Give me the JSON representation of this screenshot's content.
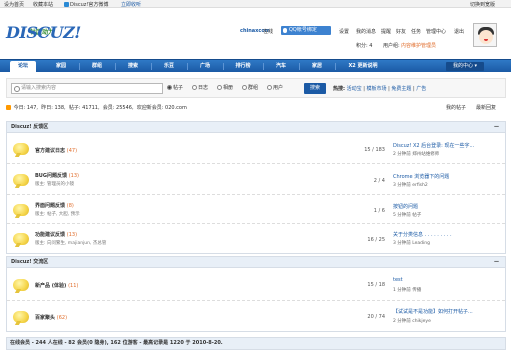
{
  "topbar": {
    "homepage": "设为首页",
    "bookmark": "收藏本站",
    "mobile": "Discuz!官方微博",
    "mobile2": "立即收听",
    "switch": "切换到宽版"
  },
  "header": {
    "logo": "DISCUZ!",
    "logo_sub": "社区动力",
    "user": "chinaxcom",
    "online": "在线",
    "qqbind": "QQ帐号绑定",
    "links": [
      "设置",
      "我的消息",
      "提醒",
      "好友",
      "任务",
      "管理中心",
      "退出"
    ],
    "points_label": "积分: 4",
    "group_label": "用户组:",
    "group": "内容维护管理员"
  },
  "nav": {
    "items": [
      "论坛",
      "家园",
      "群组",
      "搜索",
      "乐豆",
      "广场",
      "排行榜",
      "汽车",
      "家居",
      "X2 更新说明"
    ],
    "active": 0,
    "my_center": "我的中心"
  },
  "search": {
    "placeholder": "请输入搜索内容",
    "options": [
      "帖子",
      "日志",
      "相册",
      "群组",
      "用户"
    ],
    "selected": 0,
    "button": "搜索",
    "hot_label": "热搜:",
    "hot": [
      "活动宝",
      "模板市场",
      "免费主题",
      "广告"
    ]
  },
  "stats": {
    "today": "今日: 147",
    "yesterday": "昨日: 138",
    "posts": "帖子: 41711",
    "members": "会员: 25546",
    "newest": "欢迎新会员: 020.com",
    "my_posts": "我的帖子",
    "new_posts": "最新回复"
  },
  "sections": [
    {
      "title": "Discuz! 反馈区",
      "collapse": "—",
      "forums": [
        {
          "name": "官方建议日志",
          "count": "(47)",
          "mod": "",
          "nums": "15 / 183",
          "last_title": "Discuz! X2 后台登录: 现在一些字...",
          "last_meta": "2 分钟前 郑州站维修师"
        },
        {
          "name": "BUG问题反馈",
          "count": "(13)",
          "mod": "版主: 管理员的小镜",
          "nums": "2 / 4",
          "last_title": "Chrome 浏览器下的问题",
          "last_meta": "3 分钟前 erfish2"
        },
        {
          "name": "界面问题反馈",
          "count": "(8)",
          "mod": "版主: 帖子, 大胆, 预示",
          "nums": "1 / 6",
          "last_title": "按钮的问题",
          "last_meta": "5 分钟前 帖子"
        },
        {
          "name": "功能建议反馈",
          "count": "(13)",
          "mod": "版主: 向问繁生, majianjun, 杰总管",
          "nums": "16 / 25",
          "last_title": "关于分类信息 . . . . . . . . .",
          "last_meta": "3 分钟前 Leading"
        }
      ]
    },
    {
      "title": "Discuz! 交流区",
      "collapse": "—",
      "forums": [
        {
          "name": "新产品 (体验)",
          "count": "(11)",
          "mod": "",
          "nums": "15 / 18",
          "last_title": "test",
          "last_meta": "1 分钟前 传播"
        },
        {
          "name": "百家聚头",
          "count": "(62)",
          "mod": "",
          "nums": "20 / 74",
          "last_title": "【试试是不是功能】如何打开帖子...",
          "last_meta": "2 分钟前 chikjeye"
        }
      ]
    }
  ],
  "footer": "在线会员 - 244 人在线 - 82 会员(0 隐身), 162 位游客 - 最高记录是 1220 于 2010-8-20."
}
